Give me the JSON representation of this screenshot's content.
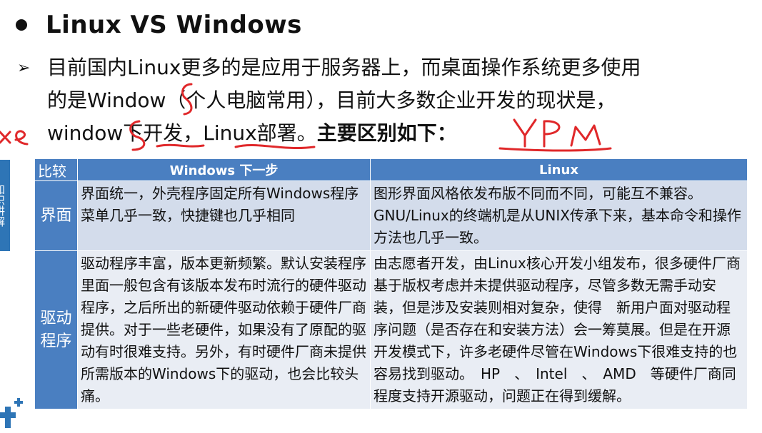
{
  "title": "Linux VS Windows",
  "paragraph": {
    "bullet": "➢",
    "line1": "目前国内Linux更多的是应用于服务器上，而桌面操作系统更多使用",
    "line2": "的是Window（个人电脑常用），目前大多数企业开发的现状是，",
    "line3_normal": "window下开发，Linux部署。",
    "line3_bold": "主要区别如下："
  },
  "side_strip_text": "知识讲解",
  "table": {
    "headers": [
      "比较",
      "Windows 下一步",
      "Linux"
    ],
    "rows": [
      {
        "label": "界面",
        "windows": "界面统一，外壳程序固定所有Windows程序菜单几乎一致，快捷键也几乎相同",
        "linux": "图形界面风格依发布版不同而不同，可能互不兼容。GNU/Linux的终端机是从UNIX传承下来，基本命令和操作方法也几乎一致。"
      },
      {
        "label": "驱动程序",
        "windows": "驱动程序丰富，版本更新频繁。默认安装程序里面一般包含有该版本发布时流行的硬件驱动程序，之后所出的新硬件驱动依赖于硬件厂商提供。对于一些老硬件，如果没有了原配的驱动有时很难支持。另外，有时硬件厂商未提供所需版本的Windows下的驱动，也会比较头痛。",
        "linux": "由志愿者开发，由Linux核心开发小组发布，很多硬件厂商基于版权考虑并未提供驱动程序，尽管多数无需手动安装，但是涉及安装则相对复杂，使得　新用户面对驱动程序问题（是否存在和安装方法）会一筹莫展。但是在开源开发模式下，许多老硬件尽管在Windows下很难支持的也容易找到驱动。　HP　、　Intel　、　AMD　等硬件厂商同程度支持开源驱动，问题正在得到缓解。"
      }
    ]
  },
  "handwriting": {
    "left_margin": "xe",
    "right_note": "YPM"
  },
  "colors": {
    "header_blue": "#4a7fc1",
    "row1_bg": "#d3dceb",
    "row2_bg": "#e9edf4",
    "ink_red": "#e0282a"
  }
}
